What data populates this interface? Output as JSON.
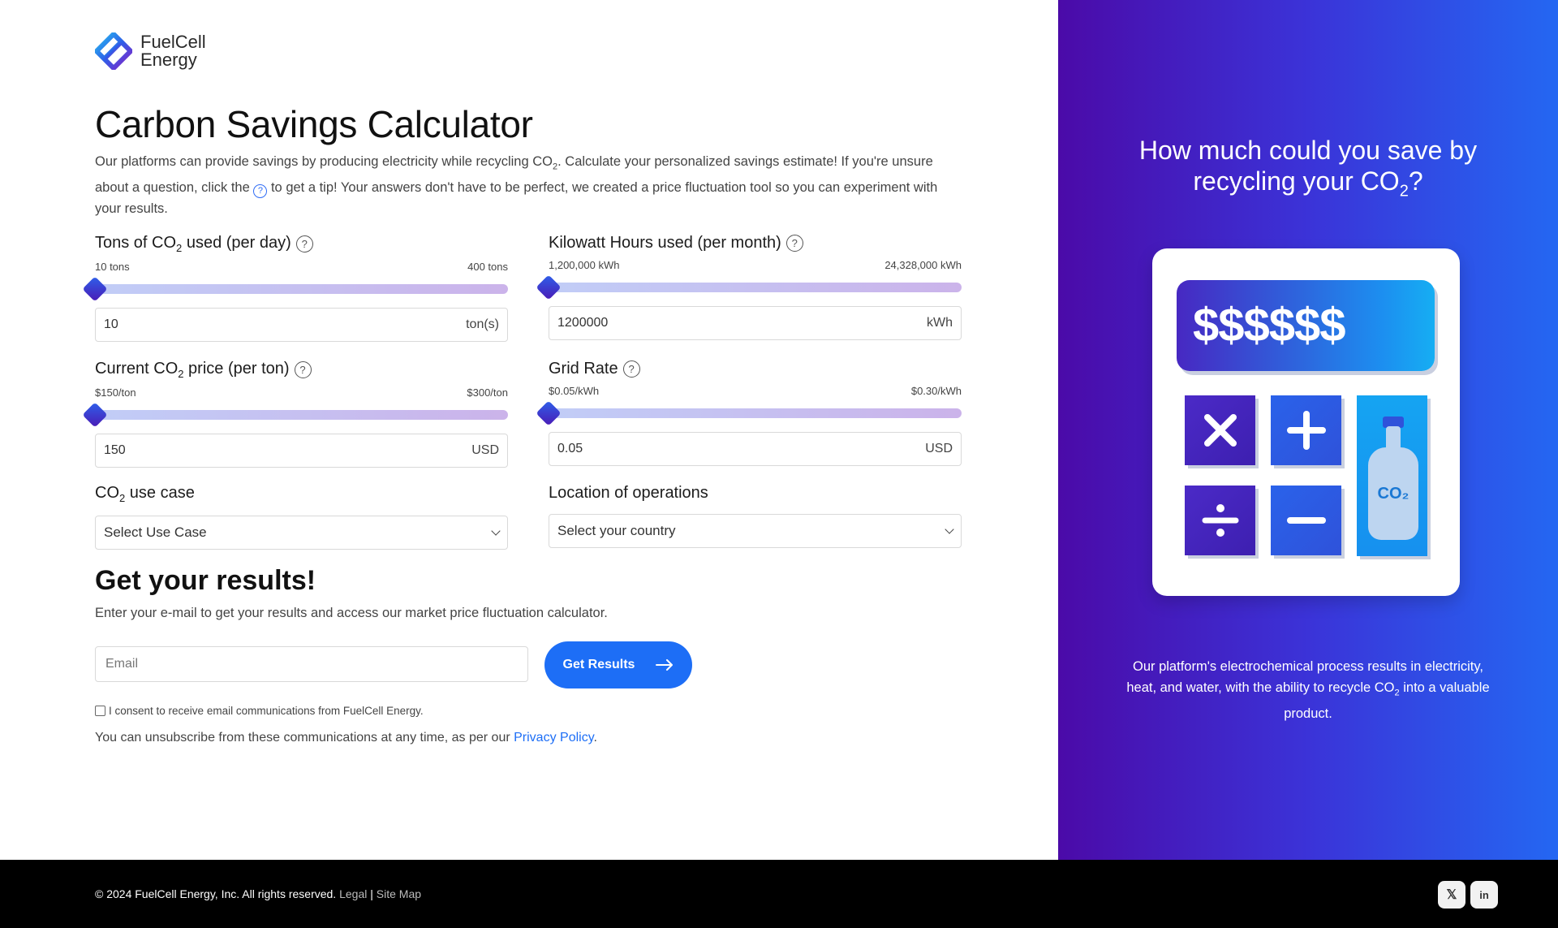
{
  "brand": {
    "line1": "FuelCell",
    "line2": "Energy"
  },
  "page": {
    "title": "Carbon Savings Calculator",
    "intro_before_sub": "Our platforms can provide savings by producing electricity while recycling CO",
    "intro_sub": "2",
    "intro_after_sub": ". Calculate your personalized savings estimate! If you're unsure about a question, click the",
    "intro_after_icon": " to get a tip! Your answers don't have to be perfect, we created a price fluctuation tool so you can experiment with your results."
  },
  "fields": {
    "tons": {
      "label_pre": "Tons of CO",
      "label_sub": "2",
      "label_post": " used (per day)",
      "min_label": "10 tons",
      "max_label": "400 tons",
      "value": "10",
      "unit": "ton(s)",
      "fraction": 0
    },
    "kwh": {
      "label": "Kilowatt Hours used (per month)",
      "min_label": "1,200,000 kWh",
      "max_label": "24,328,000 kWh",
      "value": "1200000",
      "unit": "kWh",
      "fraction": 0
    },
    "price": {
      "label_pre": "Current CO",
      "label_sub": "2",
      "label_post": " price (per ton)",
      "min_label": "$150/ton",
      "max_label": "$300/ton",
      "value": "150",
      "unit": "USD",
      "fraction": 0
    },
    "grid": {
      "label": "Grid Rate",
      "min_label": "$0.05/kWh",
      "max_label": "$0.30/kWh",
      "value": "0.05",
      "unit": "USD",
      "fraction": 0
    },
    "use_case": {
      "label_pre": "CO",
      "label_sub": "2",
      "label_post": " use case",
      "selected": "Select Use Case"
    },
    "location": {
      "label": "Location of operations",
      "selected": "Select your country"
    }
  },
  "results": {
    "title": "Get your results!",
    "subtitle": "Enter your e-mail to get your results and access our market price fluctuation calculator.",
    "email_placeholder": "Email",
    "button_label": "Get Results",
    "consent": "I consent to receive email communications from FuelCell Energy.",
    "unsub_text": "You can unsubscribe from these communications at any time, as per our ",
    "privacy_link": "Privacy Policy",
    "unsub_end": "."
  },
  "promo": {
    "title_line1": "How much could you save by",
    "title_line2_pre": "recycling your CO",
    "title_line2_sub": "2",
    "title_line2_post": "?",
    "display": "$$$$$$",
    "tank_label": "CO₂",
    "text_pre": "Our platform's electrochemical process results in electricity, heat, and water, with the ability to recycle CO",
    "text_sub": "2",
    "text_post": " into a valuable product."
  },
  "footer": {
    "copyright": "© 2024 FuelCell Energy, Inc. All rights reserved.",
    "legal": "Legal",
    "separator": "|",
    "sitemap": "Site Map",
    "x_glyph": "𝕏",
    "linkedin_glyph": "in"
  },
  "colors": {
    "accent": "#1d6ef6",
    "panel_start": "#4b0aa8",
    "panel_end": "#2467f2"
  }
}
